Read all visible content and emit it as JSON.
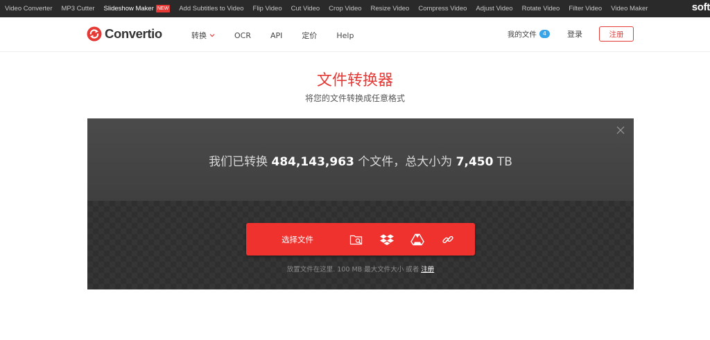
{
  "topbar": {
    "links": [
      {
        "label": "Video Converter"
      },
      {
        "label": "MP3 Cutter"
      },
      {
        "label": "Slideshow Maker",
        "badge": "NEW",
        "active": true
      },
      {
        "label": "Add Subtitles to Video"
      },
      {
        "label": "Flip Video"
      },
      {
        "label": "Cut Video"
      },
      {
        "label": "Crop Video"
      },
      {
        "label": "Resize Video"
      },
      {
        "label": "Compress Video"
      },
      {
        "label": "Adjust Video"
      },
      {
        "label": "Rotate Video"
      },
      {
        "label": "Filter Video"
      },
      {
        "label": "Video Maker"
      }
    ],
    "brand": "soft"
  },
  "header": {
    "logo_text": "Convertio",
    "nav": [
      "转换",
      "OCR",
      "API",
      "定价",
      "Help"
    ],
    "my_files_label": "我的文件",
    "my_files_count": "4",
    "login_label": "登录",
    "register_label": "注册"
  },
  "hero": {
    "title": "文件转换器",
    "subtitle": "将您的文件转换成任意格式"
  },
  "converter": {
    "stats_prefix": "我们已转换",
    "files_count": "484,143,963",
    "stats_middle": "个文件，总大小为",
    "total_size": "7,450",
    "size_unit": "TB",
    "choose_label": "选择文件",
    "source_icons": [
      "folder-search-icon",
      "dropbox-icon",
      "google-drive-icon",
      "url-link-icon"
    ],
    "drop_hint": "放置文件在这里. 100 MB 最大文件大小 或者",
    "drop_hint_link": "注册"
  },
  "colors": {
    "accent": "#f0322e",
    "badge_blue": "#3aa4e8",
    "topbar_bg": "#2a2a2a"
  }
}
